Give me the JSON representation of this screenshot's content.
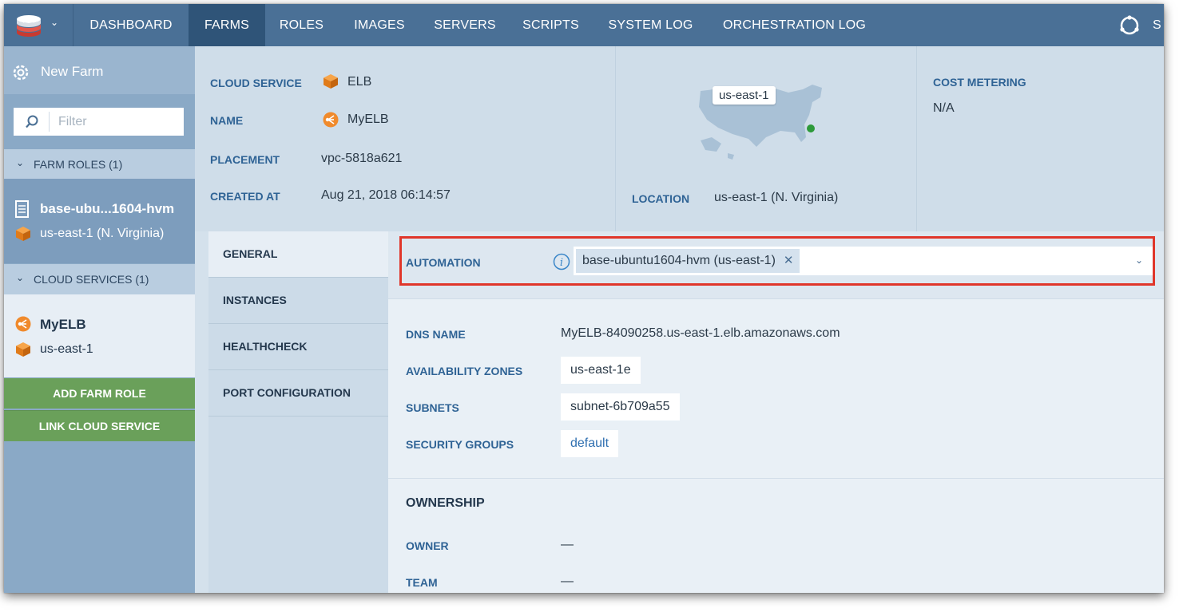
{
  "nav": {
    "items": [
      "DASHBOARD",
      "FARMS",
      "ROLES",
      "IMAGES",
      "SERVERS",
      "SCRIPTS",
      "SYSTEM LOG",
      "ORCHESTRATION LOG"
    ],
    "active": "FARMS",
    "truncated_right": "S"
  },
  "sidebar": {
    "new_farm_label": "New Farm",
    "filter_placeholder": "Filter",
    "farm_roles_header": "FARM ROLES (1)",
    "farm_role": {
      "name": "base-ubu...1604-hvm",
      "location": "us-east-1 (N. Virginia)"
    },
    "cloud_services_header": "CLOUD SERVICES (1)",
    "cloud_service": {
      "name": "MyELB",
      "location": "us-east-1"
    },
    "add_farm_role": "ADD FARM ROLE",
    "link_cloud_service": "LINK CLOUD SERVICE"
  },
  "summary": {
    "cloud_service_label": "CLOUD SERVICE",
    "cloud_service_value": "ELB",
    "name_label": "NAME",
    "name_value": "MyELB",
    "placement_label": "PLACEMENT",
    "placement_value": "vpc-5818a621",
    "created_label": "CREATED AT",
    "created_value": "Aug 21, 2018 06:14:57",
    "map_region": "us-east-1",
    "location_label": "LOCATION",
    "location_value": "us-east-1 (N. Virginia)",
    "cost_label": "COST METERING",
    "cost_value": "N/A"
  },
  "tabs": [
    "GENERAL",
    "INSTANCES",
    "HEALTHCHECK",
    "PORT CONFIGURATION"
  ],
  "general": {
    "automation_label": "AUTOMATION",
    "automation_tag": "base-ubuntu1604-hvm (us-east-1)",
    "dns_label": "DNS NAME",
    "dns_value": "MyELB-84090258.us-east-1.elb.amazonaws.com",
    "az_label": "AVAILABILITY ZONES",
    "az_value": "us-east-1e",
    "subnets_label": "SUBNETS",
    "subnets_value": "subnet-6b709a55",
    "sg_label": "SECURITY GROUPS",
    "sg_value": "default",
    "ownership_header": "OWNERSHIP",
    "owner_label": "OWNER",
    "owner_value": "—",
    "team_label": "TEAM",
    "team_value": "—"
  },
  "colors": {
    "nav_bg": "#4a7096",
    "nav_active": "#2f5478",
    "label_blue": "#2f6395",
    "green_button": "#6aa05a",
    "highlight_red": "#e0362a",
    "orange_icon": "#f08a2c"
  }
}
